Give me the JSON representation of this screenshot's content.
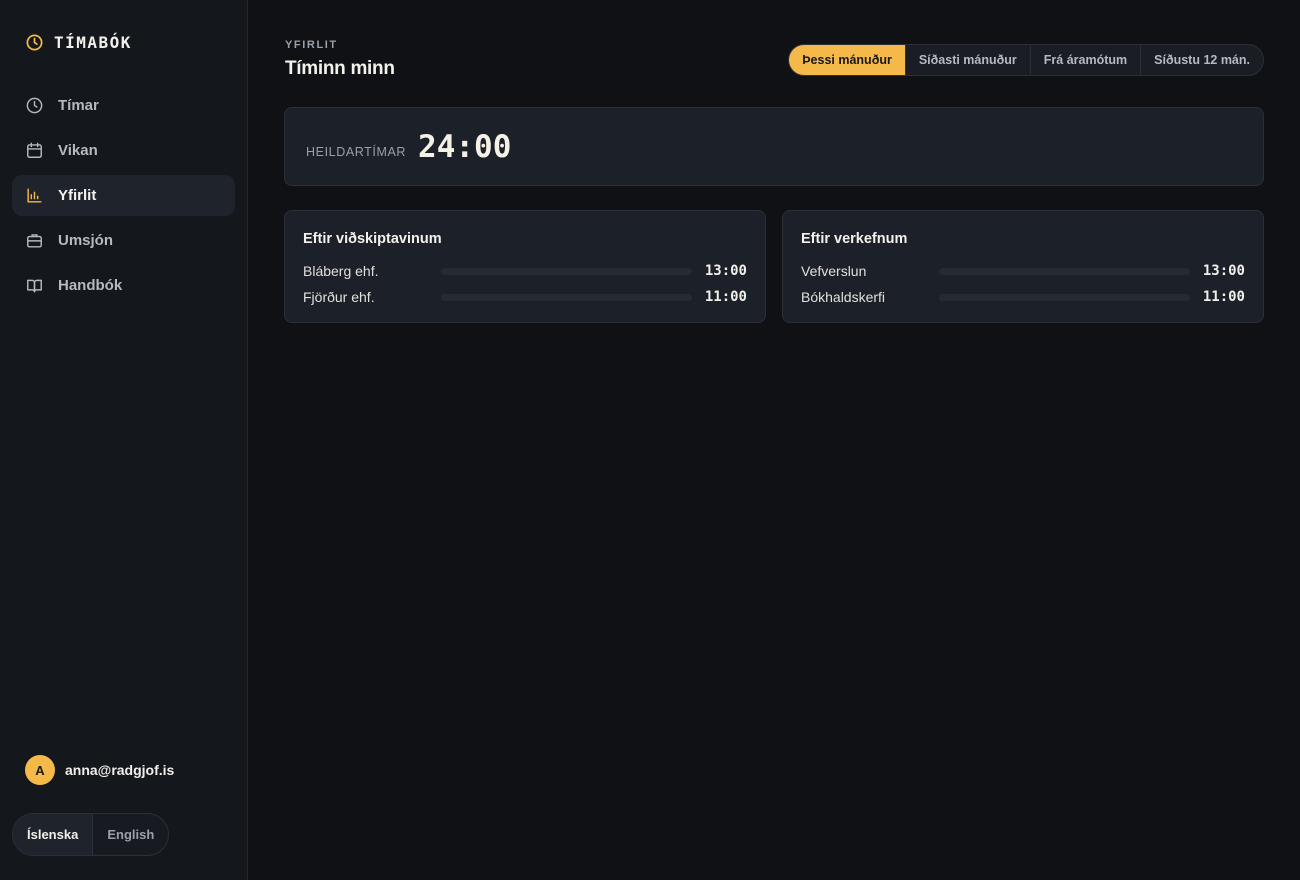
{
  "brand": {
    "name": "TÍMABÓK",
    "icon": "clock-icon",
    "accent": "#f4b949"
  },
  "sidebar": {
    "items": [
      {
        "label": "Tímar",
        "icon": "clock-icon",
        "active": false
      },
      {
        "label": "Vikan",
        "icon": "calendar-icon",
        "active": false
      },
      {
        "label": "Yfirlit",
        "icon": "bar-chart-icon",
        "active": true
      },
      {
        "label": "Umsjón",
        "icon": "briefcase-icon",
        "active": false
      },
      {
        "label": "Handbók",
        "icon": "book-icon",
        "active": false
      }
    ],
    "user": {
      "initial": "A",
      "email": "anna@radgjof.is"
    },
    "languages": [
      {
        "label": "Íslenska",
        "active": true
      },
      {
        "label": "English",
        "active": false
      }
    ]
  },
  "header": {
    "eyebrow": "YFIRLIT",
    "title": "Tíminn minn",
    "ranges": [
      {
        "label": "Þessi mánuður",
        "active": true
      },
      {
        "label": "Síðasti mánuður",
        "active": false
      },
      {
        "label": "Frá áramótum",
        "active": false
      },
      {
        "label": "Síðustu 12 mán.",
        "active": false
      }
    ]
  },
  "total": {
    "label": "HEILDARTÍMAR",
    "value": "24:00"
  },
  "breakdowns": {
    "clients": {
      "title": "Eftir viðskiptavinum",
      "rows": [
        {
          "label": "Bláberg ehf.",
          "value": "13:00",
          "fraction": 1.0
        },
        {
          "label": "Fjörður ehf.",
          "value": "11:00",
          "fraction": 0.846
        }
      ]
    },
    "projects": {
      "title": "Eftir verkefnum",
      "rows": [
        {
          "label": "Vefverslun",
          "value": "13:00",
          "fraction": 1.0
        },
        {
          "label": "Bókhaldskerfi",
          "value": "11:00",
          "fraction": 0.846
        }
      ]
    }
  }
}
